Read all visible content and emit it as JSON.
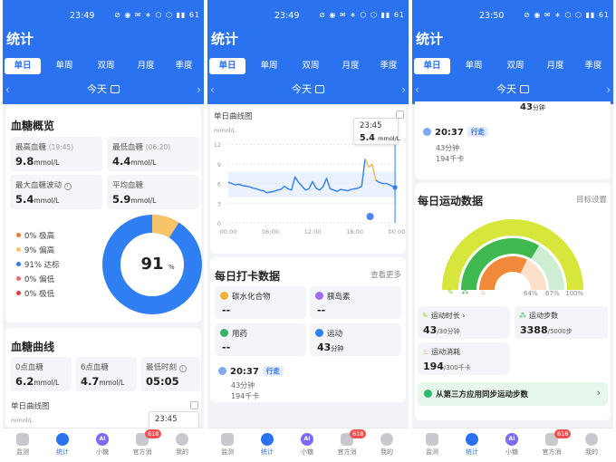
{
  "screens": [
    {
      "status_time": "23:49",
      "status_icons": "⊘ ◉ ✉ ∗ ⬡ ⬡ ▮▮ 61"
    },
    {
      "status_time": "23:49",
      "status_icons": "⊘ ◉ ✉ ∗ ⬡ ⬡ ▮▮ 61"
    },
    {
      "status_time": "23:50",
      "status_icons": "⊘ ◉ ✉ ∗ ⬡ ⬡ ▮▮ 61"
    }
  ],
  "page_title": "统计",
  "tabs": [
    "单日",
    "单周",
    "双周",
    "月度",
    "季度"
  ],
  "active_tab": "单日",
  "date_label": "今天",
  "overview": {
    "title": "血糖概览",
    "max": {
      "label": "最高血糖",
      "time": "(19:45)",
      "value": "9.8",
      "unit": "mmol/L"
    },
    "min": {
      "label": "最低血糖",
      "time": "(06:20)",
      "value": "4.4",
      "unit": "mmol/L"
    },
    "fluct": {
      "label": "最大血糖波动",
      "value": "5.4",
      "unit": "mmol/L"
    },
    "avg": {
      "label": "平均血糖",
      "value": "5.9",
      "unit": "mmol/L"
    },
    "ranges": [
      {
        "label": "0% 极高",
        "color": "#f07a2a",
        "pct": 0
      },
      {
        "label": "9% 偏高",
        "color": "#f7c46a",
        "pct": 9
      },
      {
        "label": "91% 达标",
        "color": "#2f7ef2",
        "pct": 91
      },
      {
        "label": "0% 偏低",
        "color": "#f06a6a",
        "pct": 0
      },
      {
        "label": "0% 极低",
        "color": "#e33a3a",
        "pct": 0
      }
    ],
    "donut_value": "91",
    "donut_unit": "%"
  },
  "curve": {
    "title": "血糖曲线",
    "zero": {
      "label": "0点血糖",
      "value": "6.2",
      "unit": "mmol/L"
    },
    "six": {
      "label": "6点血糖",
      "value": "4.7",
      "unit": "mmol/L"
    },
    "latest": {
      "label": "最低时刻",
      "value": "05:05"
    },
    "chart_title": "单日曲线图",
    "unit_label": "mmol/L"
  },
  "tooltip": {
    "time": "23:45",
    "value": "5.4",
    "unit": "mmol/L"
  },
  "chart_data": {
    "type": "line",
    "title": "单日曲线图",
    "ylabel": "mmol/L",
    "x_ticks": [
      "00:00",
      "06:00",
      "12:00",
      "18:00",
      "00:00"
    ],
    "y_ticks": [
      "0",
      "3",
      "6",
      "9",
      "12"
    ],
    "ylim": [
      0,
      13
    ],
    "target_range": [
      3.9,
      7.8
    ],
    "series": [
      {
        "x": [
          0,
          0.5,
          1,
          1.5,
          2,
          2.5,
          3,
          3.5,
          4,
          4.5,
          5,
          5.5,
          6,
          6.5,
          7,
          7.5,
          8,
          8.5,
          9,
          9.5,
          10,
          10.5,
          11,
          11.5,
          12,
          12.5,
          13,
          13.5,
          14,
          14.5,
          15,
          15.5,
          16,
          16.5,
          17,
          17.5,
          18,
          18.5,
          19,
          19.5,
          20,
          20.5,
          21,
          21.5,
          22,
          22.5,
          23,
          23.75
        ],
        "y": [
          6.2,
          6.0,
          5.8,
          5.9,
          5.7,
          5.6,
          5.5,
          5.3,
          5.2,
          5.0,
          4.9,
          4.6,
          4.7,
          4.8,
          5.0,
          5.1,
          5.6,
          5.2,
          5.0,
          7.0,
          6.2,
          5.6,
          5.0,
          5.2,
          6.3,
          5.3,
          5.0,
          5.5,
          6.8,
          5.2,
          5.0,
          4.8,
          5.1,
          5.0,
          4.9,
          5.1,
          5.2,
          5.3,
          5.6,
          9.8,
          8.5,
          8.9,
          6.5,
          6.2,
          6.0,
          6.0,
          5.8,
          5.4
        ]
      }
    ]
  },
  "checkin": {
    "title": "每日打卡数据",
    "more": "查看更多",
    "carb_label": "碳水化合物",
    "insulin_label": "胰岛素",
    "med_label": "用药",
    "exercise_label": "运动",
    "dash": "--",
    "exercise_value": "43",
    "exercise_unit": "分钟"
  },
  "walk": {
    "time": "20:37",
    "tag": "行走",
    "duration": "43分钟",
    "kcal": "194千卡"
  },
  "sport": {
    "partial_value": "43",
    "partial_unit": "分钟",
    "title": "每日运动数据",
    "settings": "目标设置",
    "gauge_ticks": [
      "64%",
      "67%",
      "100%"
    ],
    "duration_label": "运动时长",
    "duration_value": "43",
    "duration_goal": "/30分钟",
    "steps_label": "运动步数",
    "steps_value": "3388",
    "steps_goal": "/5000步",
    "kcal_label": "运动消耗",
    "kcal_value": "194",
    "kcal_goal": "/300千卡",
    "sync_label": "从第三方应用同步运动步数",
    "duration_pct": 100,
    "steps_pct": 67,
    "kcal_pct": 64
  },
  "nav": [
    "监测",
    "统计",
    "小糖",
    "官方消",
    "我的"
  ],
  "nav_badge": "618",
  "ai_label": "AI",
  "colors": {
    "primary": "#2a72f0",
    "gauge_outer": "#d6e63a",
    "gauge_mid": "#3fb94f",
    "gauge_inner": "#f08a3a"
  }
}
